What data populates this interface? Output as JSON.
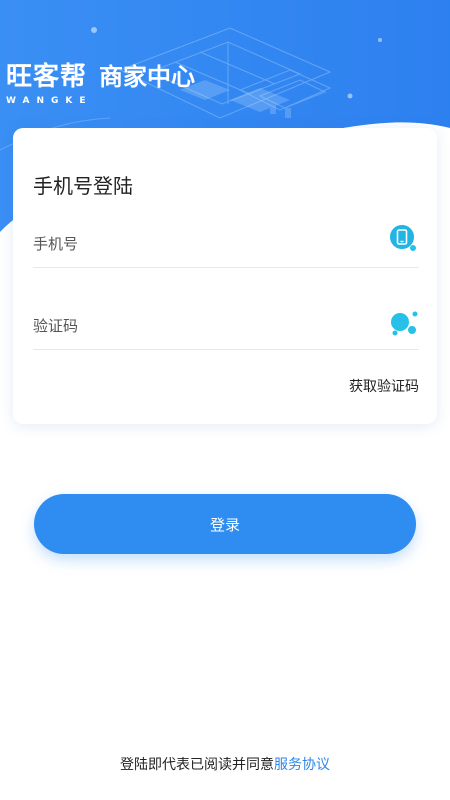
{
  "brand": {
    "name": "旺客帮",
    "latin": "WANGKE",
    "subtitle": "商家中心"
  },
  "login": {
    "title": "手机号登陆",
    "phone_placeholder": "手机号",
    "code_placeholder": "验证码",
    "get_code": "获取验证码",
    "submit": "登录"
  },
  "footer": {
    "agreement_text": "登陆即代表已阅读并同意",
    "agreement_link": "服务协议"
  },
  "colors": {
    "primary": "#2f8cf0",
    "hero_blue": "#2e86f2",
    "link": "#2f86e8",
    "icon_cyan": "#27c0e8"
  },
  "icons": {
    "phone_field": "mobile-phone-icon",
    "code_field": "bubbles-icon"
  }
}
